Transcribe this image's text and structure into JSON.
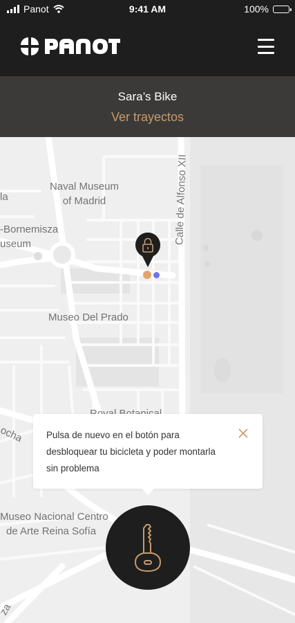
{
  "status": {
    "carrier": "Panot",
    "time": "9:41 AM",
    "battery": "100%"
  },
  "header": {
    "logo_text": "panot"
  },
  "bike": {
    "name": "Sara’s Bike",
    "trips_link": "Ver trayectos"
  },
  "map": {
    "labels": {
      "naval_museum_1": "Naval Museum",
      "naval_museum_2": "of Madrid",
      "bornemisza_1": "-Bornemisza",
      "bornemisza_2": "useum",
      "la": "la",
      "prado": "Museo Del Prado",
      "alfonso": "Calle de Alfonso XII",
      "botanical": "Royal Botanical",
      "ocha": "ocha",
      "reina_1": "Museo Nacional Centro",
      "reina_2": "de Arte Reina Sofía",
      "za": "za"
    }
  },
  "tooltip": {
    "text": "Pulsa de nuevo en el botón para desbloquear tu bicicleta y poder montarla sin problema"
  },
  "colors": {
    "accent": "#c79a6b",
    "dark": "#1e1e1e",
    "subheader": "#3b3a39",
    "map_bg": "#efefef",
    "gps": "#6a73f2"
  }
}
